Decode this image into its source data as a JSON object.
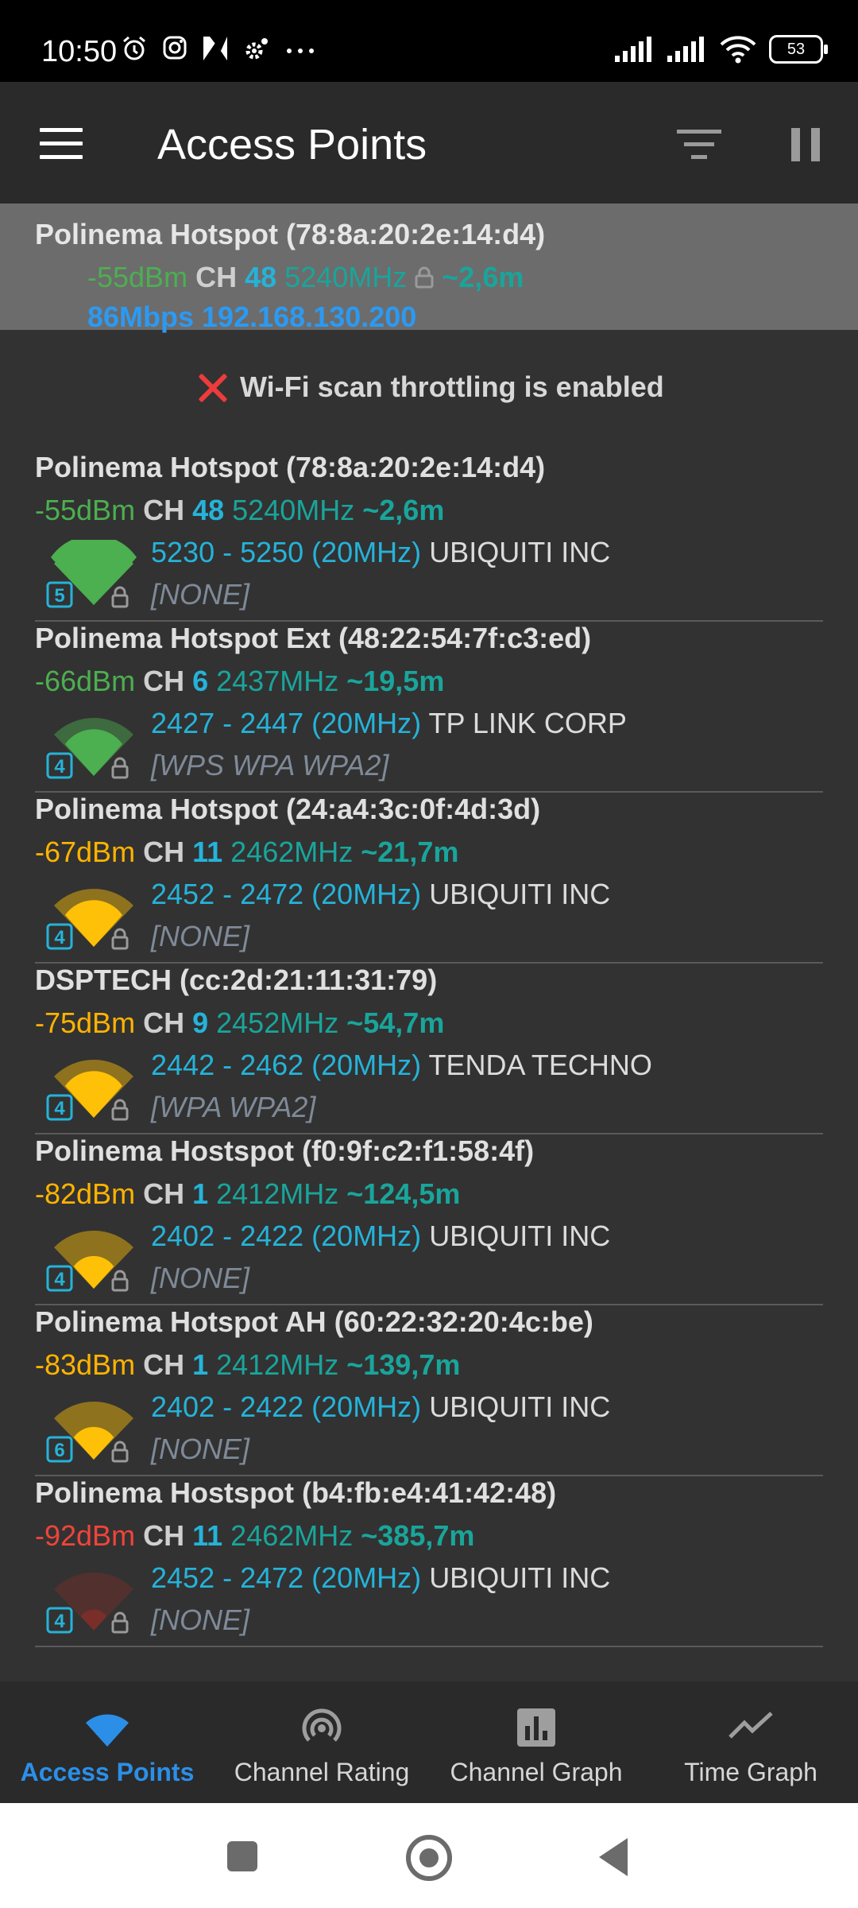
{
  "status_bar": {
    "time": "10:50",
    "battery": "53",
    "left_icons": [
      "alarm-icon",
      "instagram-icon",
      "gallery-icon",
      "settings-icon",
      "more-dots-icon"
    ],
    "right_icons": [
      "signal-icon",
      "signal-icon",
      "wifi-icon",
      "battery-icon"
    ]
  },
  "app_bar": {
    "title": "Access Points"
  },
  "connected": {
    "ssid": "Polinema Hotspot (78:8a:20:2e:14:d4)",
    "dbm": "-55dBm",
    "ch_label": "CH",
    "ch": "48",
    "freq": "5240MHz",
    "dist": "~2,6m",
    "speed_ip": "86Mbps 192.168.130.200"
  },
  "warning": {
    "text": "Wi-Fi scan throttling is enabled"
  },
  "access_points": [
    {
      "title": "Polinema Hotspot (78:8a:20:2e:14:d4)",
      "dbm": "-55dBm",
      "ch_label": "CH",
      "ch": "48",
      "freq": "5240MHz",
      "dist": "~2,6m",
      "range": "5230 - 5250 (20MHz)",
      "vendor": "UBIQUITI INC",
      "security": "[NONE]",
      "band": "5",
      "strength_color": "#4caf50",
      "dbm_color": "#4caf50",
      "ch_color": "#25b3d9",
      "wifi_bars": 3
    },
    {
      "title": "Polinema Hotspot Ext (48:22:54:7f:c3:ed)",
      "dbm": "-66dBm",
      "ch_label": "CH",
      "ch": "6",
      "freq": "2437MHz",
      "dist": "~19,5m",
      "range": "2427 - 2447 (20MHz)",
      "vendor": "TP LINK CORP",
      "security": "[WPS WPA WPA2]",
      "band": "4",
      "strength_color": "#4caf50",
      "dbm_color": "#4caf50",
      "ch_color": "#25b3d9",
      "wifi_bars": 2
    },
    {
      "title": "Polinema Hotspot (24:a4:3c:0f:4d:3d)",
      "dbm": "-67dBm",
      "ch_label": "CH",
      "ch": "11",
      "freq": "2462MHz",
      "dist": "~21,7m",
      "range": "2452 - 2472 (20MHz)",
      "vendor": "UBIQUITI INC",
      "security": "[NONE]",
      "band": "4",
      "strength_color": "#ffc107",
      "dbm_color": "#ffb300",
      "ch_color": "#25b3d9",
      "wifi_bars": 2
    },
    {
      "title": "DSPTECH (cc:2d:21:11:31:79)",
      "dbm": "-75dBm",
      "ch_label": "CH",
      "ch": "9",
      "freq": "2452MHz",
      "dist": "~54,7m",
      "range": "2442 - 2462 (20MHz)",
      "vendor": "TENDA TECHNO",
      "security": "[WPA WPA2]",
      "band": "4",
      "strength_color": "#ffc107",
      "dbm_color": "#ffb300",
      "ch_color": "#25b3d9",
      "wifi_bars": 2
    },
    {
      "title": "Polinema Hostspot (f0:9f:c2:f1:58:4f)",
      "dbm": "-82dBm",
      "ch_label": "CH",
      "ch": "1",
      "freq": "2412MHz",
      "dist": "~124,5m",
      "range": "2402 - 2422 (20MHz)",
      "vendor": "UBIQUITI INC",
      "security": "[NONE]",
      "band": "4",
      "strength_color": "#ffc107",
      "dbm_color": "#ffb300",
      "ch_color": "#25b3d9",
      "wifi_bars": 1
    },
    {
      "title": "Polinema Hotspot AH (60:22:32:20:4c:be)",
      "dbm": "-83dBm",
      "ch_label": "CH",
      "ch": "1",
      "freq": "2412MHz",
      "dist": "~139,7m",
      "range": "2402 - 2422 (20MHz)",
      "vendor": "UBIQUITI INC",
      "security": "[NONE]",
      "band": "6",
      "strength_color": "#ffc107",
      "dbm_color": "#ffb300",
      "ch_color": "#25b3d9",
      "wifi_bars": 1
    },
    {
      "title": "Polinema Hostspot (b4:fb:e4:41:42:48)",
      "dbm": "-92dBm",
      "ch_label": "CH",
      "ch": "11",
      "freq": "2462MHz",
      "dist": "~385,7m",
      "range": "2452 - 2472 (20MHz)",
      "vendor": "UBIQUITI INC",
      "security": "[NONE]",
      "band": "4",
      "strength_color": "#7a2e2a",
      "dbm_color": "#f0443a",
      "ch_color": "#25b3d9",
      "wifi_bars": 0
    }
  ],
  "bottom_nav": {
    "items": [
      {
        "label": "Access Points",
        "icon": "wifi-icon",
        "active": true
      },
      {
        "label": "Channel Rating",
        "icon": "radar-icon",
        "active": false
      },
      {
        "label": "Channel Graph",
        "icon": "bar-chart-icon",
        "active": false
      },
      {
        "label": "Time Graph",
        "icon": "line-chart-icon",
        "active": false
      }
    ],
    "active_color": "#2b8fe8"
  }
}
